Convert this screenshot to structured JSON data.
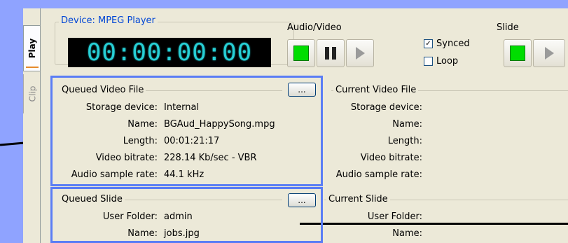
{
  "tabs": {
    "play": "Play",
    "clip": "Clip"
  },
  "device": {
    "title": "Device: MPEG Player",
    "timecode": "00:00:00:00"
  },
  "audio_video": {
    "label": "Audio/Video",
    "synced_label": "Synced",
    "synced_checked": true,
    "loop_label": "Loop",
    "loop_checked": false
  },
  "slide": {
    "label": "Slide"
  },
  "queued_video": {
    "title": "Queued Video File",
    "browse_label": "...",
    "rows": [
      {
        "label": "Storage device:",
        "value": "Internal"
      },
      {
        "label": "Name:",
        "value": "BGAud_HappySong.mpg"
      },
      {
        "label": "Length:",
        "value": "00:01:21:17"
      },
      {
        "label": "Video bitrate:",
        "value": "228.14 Kb/sec - VBR"
      },
      {
        "label": "Audio sample rate:",
        "value": "44.1 kHz"
      }
    ]
  },
  "current_video": {
    "title": "Current Video File",
    "rows": [
      {
        "label": "Storage device:"
      },
      {
        "label": "Name:"
      },
      {
        "label": "Length:"
      },
      {
        "label": "Video bitrate:"
      },
      {
        "label": "Audio sample rate:"
      }
    ]
  },
  "queued_slide": {
    "title": "Queued Slide",
    "browse_label": "...",
    "rows": [
      {
        "label": "User Folder:",
        "value": "admin"
      },
      {
        "label": "Name:",
        "value": "jobs.jpg"
      }
    ]
  },
  "current_slide": {
    "title": "Current Slide",
    "rows": [
      {
        "label": "User Folder:"
      },
      {
        "label": "Name:"
      }
    ]
  },
  "colors": {
    "background": "#8fa3ff",
    "panel": "#ece9d8",
    "highlight": "#5a7df5",
    "timecode_text": "#27d0d6",
    "stop_green": "#00dd00"
  }
}
